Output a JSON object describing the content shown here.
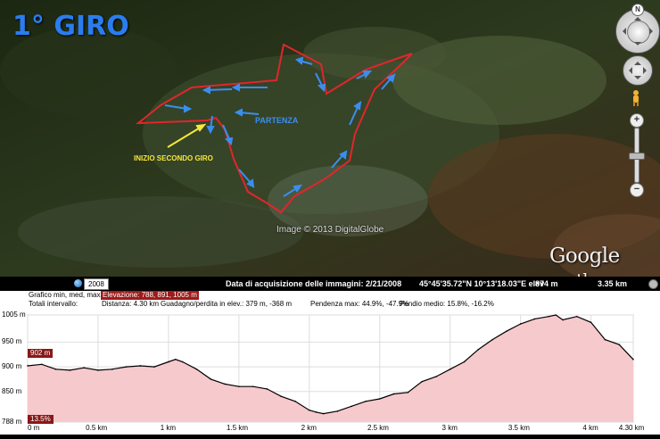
{
  "map": {
    "title": "1° GIRO",
    "partenza_label": "PARTENZA",
    "inizio_label": "INIZIO SECONDO GIRO",
    "copyright": "Image © 2013 DigitalGlobe",
    "logo_brand": "Google",
    "logo_product": "earth",
    "route_color": "#e0262c",
    "arrow_color": "#3a8ef0",
    "inizio_arrow_color": "#f5e83a"
  },
  "nav": {
    "north_label": "N",
    "zoom_in": "+",
    "zoom_out": "−"
  },
  "status": {
    "year_badge": "2008",
    "acquisition": "Data di acquisizione delle immagini: 2/21/2008",
    "coords": "45°45'35.72\"N  10°13'18.03\"E  elev",
    "elev_value": "874 m",
    "eye_alt": "3.35 km"
  },
  "profile": {
    "row1_label": "Grafico  min, med, max:",
    "row1_value": "Elevazione: 788, 891, 1005 m",
    "row2_label": "Totali intervallo:",
    "distance": "Distanza: 4.30 km",
    "gain_loss": "Guadagno/perdita in elev.: 379 m, -368 m",
    "max_slope": "Pendenza max: 44.9%, -47.9%",
    "avg_slope": "Pendio medio: 15.8%, -16.2%",
    "cursor_elev": "902 m",
    "cursor_slope": "13.5%",
    "fill_color": "#f6c9cc",
    "line_color": "#000000"
  },
  "chart_data": {
    "type": "area",
    "xlabel": "",
    "ylabel": "",
    "ylim": [
      788,
      1005
    ],
    "xlim": [
      0,
      4.3
    ],
    "y_ticks": [
      "1005 m",
      "950 m",
      "900 m",
      "850 m",
      "788 m"
    ],
    "x_ticks": [
      "0 m",
      "0.5 km",
      "1 km",
      "1.5 km",
      "2 km",
      "2.5 km",
      "3 km",
      "3.5 km",
      "4 km",
      "4.30 km"
    ],
    "x": [
      0,
      0.1,
      0.2,
      0.3,
      0.4,
      0.5,
      0.6,
      0.7,
      0.8,
      0.9,
      1.0,
      1.05,
      1.1,
      1.2,
      1.3,
      1.4,
      1.5,
      1.6,
      1.7,
      1.8,
      1.9,
      2.0,
      2.05,
      2.1,
      2.2,
      2.3,
      2.4,
      2.5,
      2.6,
      2.7,
      2.8,
      2.9,
      3.0,
      3.1,
      3.2,
      3.3,
      3.4,
      3.5,
      3.6,
      3.7,
      3.75,
      3.8,
      3.9,
      4.0,
      4.1,
      4.2,
      4.3
    ],
    "y": [
      902,
      905,
      895,
      893,
      898,
      893,
      895,
      900,
      902,
      900,
      910,
      915,
      910,
      895,
      875,
      865,
      860,
      860,
      855,
      840,
      830,
      812,
      808,
      805,
      810,
      820,
      830,
      835,
      845,
      848,
      870,
      880,
      895,
      910,
      935,
      955,
      972,
      987,
      997,
      1002,
      1005,
      995,
      1002,
      990,
      955,
      945,
      915
    ]
  }
}
